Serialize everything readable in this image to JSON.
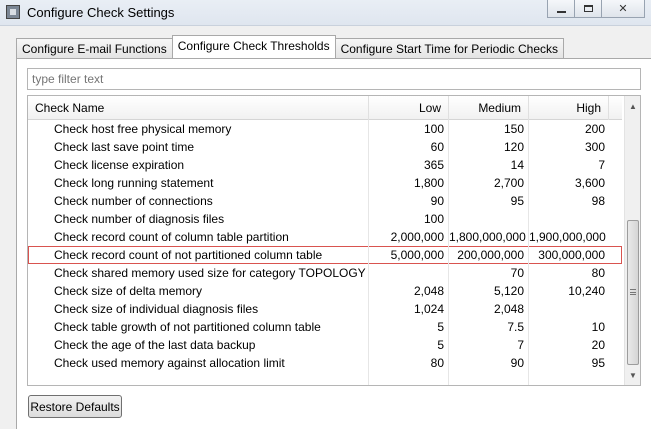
{
  "window": {
    "title": "Configure Check Settings"
  },
  "tabs": [
    {
      "label": "Configure E-mail Functions",
      "active": false
    },
    {
      "label": "Configure Check Thresholds",
      "active": true
    },
    {
      "label": "Configure Start Time for Periodic Checks",
      "active": false
    }
  ],
  "filter": {
    "placeholder": "type filter text",
    "value": ""
  },
  "table": {
    "columns": {
      "name": "Check Name",
      "low": "Low",
      "medium": "Medium",
      "high": "High"
    },
    "rows": [
      {
        "name": "Check host free physical memory",
        "low": "100",
        "medium": "150",
        "high": "200"
      },
      {
        "name": "Check last save point time",
        "low": "60",
        "medium": "120",
        "high": "300"
      },
      {
        "name": "Check license expiration",
        "low": "365",
        "medium": "14",
        "high": "7"
      },
      {
        "name": "Check long running statement",
        "low": "1,800",
        "medium": "2,700",
        "high": "3,600"
      },
      {
        "name": "Check number of connections",
        "low": "90",
        "medium": "95",
        "high": "98"
      },
      {
        "name": "Check number of diagnosis files",
        "low": "100",
        "medium": "",
        "high": ""
      },
      {
        "name": "Check record count of column table partition",
        "low": "2,000,000",
        "medium": "1,800,000,000",
        "high": "1,900,000,000"
      },
      {
        "name": "Check record count of not partitioned column table",
        "low": "5,000,000",
        "medium": "200,000,000",
        "high": "300,000,000",
        "selected": true
      },
      {
        "name": "Check shared memory used size for category TOPOLOGY",
        "low": "",
        "medium": "70",
        "high": "80"
      },
      {
        "name": "Check size of delta memory",
        "low": "2,048",
        "medium": "5,120",
        "high": "10,240"
      },
      {
        "name": "Check size of individual diagnosis files",
        "low": "1,024",
        "medium": "2,048",
        "high": ""
      },
      {
        "name": "Check table growth of not partitioned column table",
        "low": "5",
        "medium": "7.5",
        "high": "10"
      },
      {
        "name": "Check the age of the last data backup",
        "low": "5",
        "medium": "7",
        "high": "20"
      },
      {
        "name": "Check used memory against allocation limit",
        "low": "80",
        "medium": "90",
        "high": "95"
      }
    ]
  },
  "buttons": {
    "restore_defaults": "Restore Defaults"
  },
  "icons": {
    "app": "app-window-icon",
    "minimize": "minimize-icon",
    "maximize": "maximize-icon",
    "close": "close-icon",
    "scroll_up": "arrow-up-icon",
    "scroll_down": "arrow-down-icon"
  },
  "colors": {
    "selection_outline": "#d9534f"
  }
}
